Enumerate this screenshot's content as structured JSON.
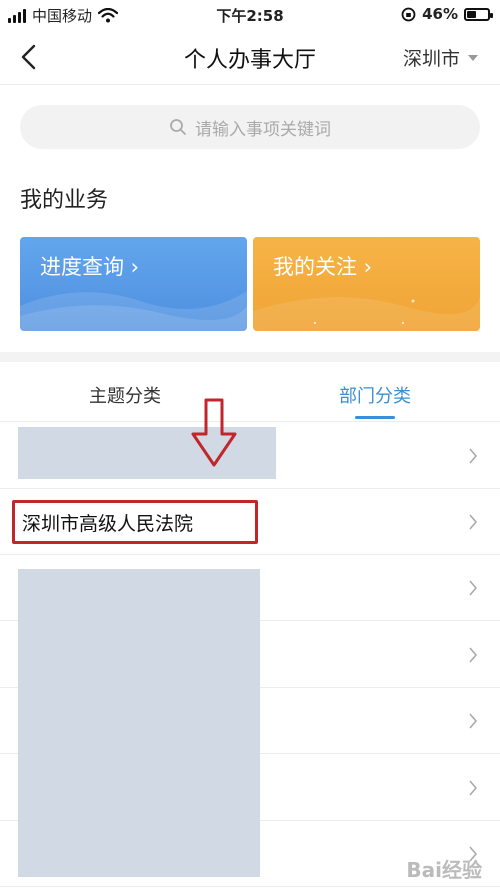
{
  "status_bar": {
    "carrier": "中国移动",
    "time": "下午2:58",
    "battery": "46%",
    "battery_level": 0.46
  },
  "nav": {
    "title": "个人办事大厅",
    "city": "深圳市"
  },
  "search": {
    "placeholder": "请输入事项关键词"
  },
  "my_business": {
    "title": "我的业务",
    "cards": [
      {
        "label": "进度查询 ›",
        "color": "#5b9ee8"
      },
      {
        "label": "我的关注 ›",
        "color": "#f2a83c"
      }
    ]
  },
  "tabs": [
    {
      "label": "主题分类",
      "active": false
    },
    {
      "label": "部门分类",
      "active": true
    }
  ],
  "departments": [
    {
      "label": ""
    },
    {
      "label": "深圳市高级人民法院"
    },
    {
      "label": ""
    },
    {
      "label": ""
    },
    {
      "label": ""
    },
    {
      "label": ""
    },
    {
      "label": ""
    }
  ],
  "colors": {
    "accent": "#3a8fd8",
    "highlight": "#c0262b",
    "redaction": "#d0d9e4"
  },
  "watermark": "Bai经验"
}
